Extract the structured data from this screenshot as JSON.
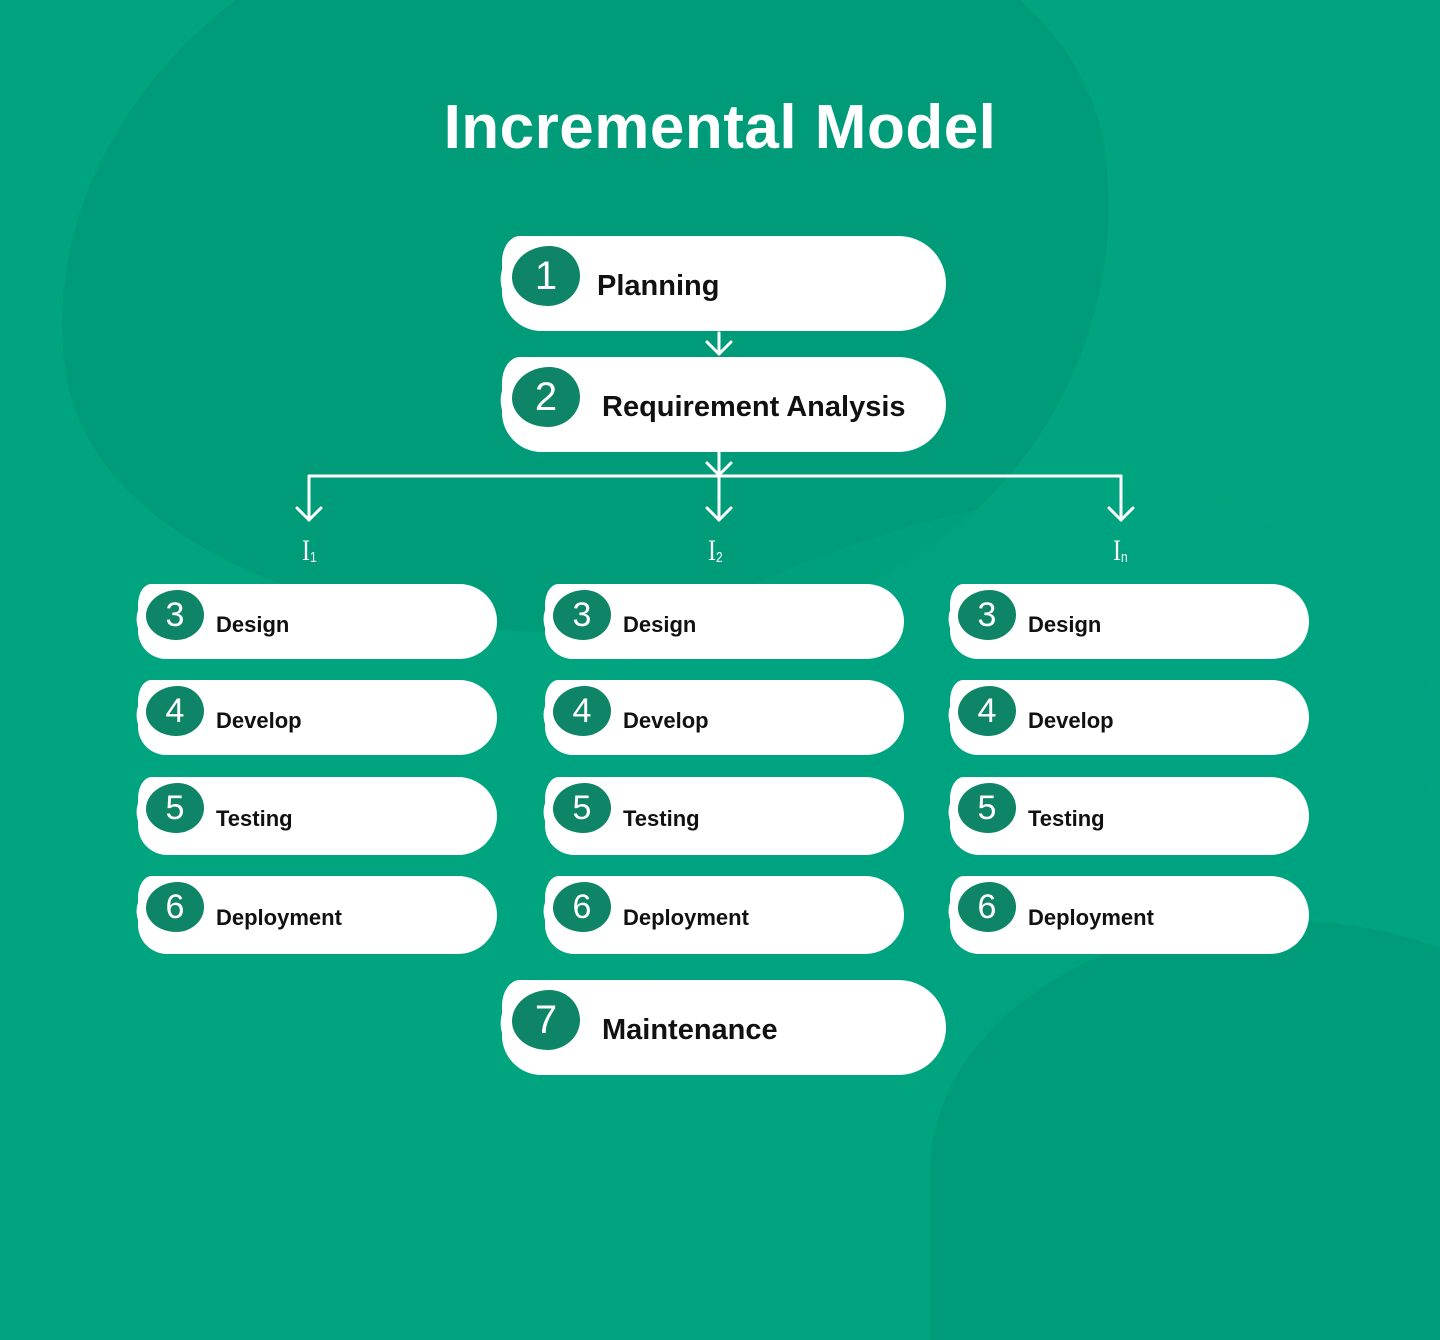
{
  "title": "Incremental Model",
  "colors": {
    "background": "#00A47F",
    "blob": "#009C7A",
    "step_number_bg": "#0E8566",
    "pill": "#FFFFFF",
    "text_dark": "#111111",
    "text_light": "#FFFFFF"
  },
  "top_steps": [
    {
      "number": "1",
      "label": "Planning"
    },
    {
      "number": "2",
      "label": "Requirement Analysis"
    }
  ],
  "iterations": [
    {
      "name": "I",
      "subscript": "1",
      "steps": [
        {
          "number": "3",
          "label": "Design"
        },
        {
          "number": "4",
          "label": "Develop"
        },
        {
          "number": "5",
          "label": "Testing"
        },
        {
          "number": "6",
          "label": "Deployment"
        }
      ]
    },
    {
      "name": "I",
      "subscript": "2",
      "steps": [
        {
          "number": "3",
          "label": "Design"
        },
        {
          "number": "4",
          "label": "Develop"
        },
        {
          "number": "5",
          "label": "Testing"
        },
        {
          "number": "6",
          "label": "Deployment"
        }
      ]
    },
    {
      "name": "I",
      "subscript": "n",
      "steps": [
        {
          "number": "3",
          "label": "Design"
        },
        {
          "number": "4",
          "label": "Develop"
        },
        {
          "number": "5",
          "label": "Testing"
        },
        {
          "number": "6",
          "label": "Deployment"
        }
      ]
    }
  ],
  "final_step": {
    "number": "7",
    "label": "Maintenance"
  }
}
